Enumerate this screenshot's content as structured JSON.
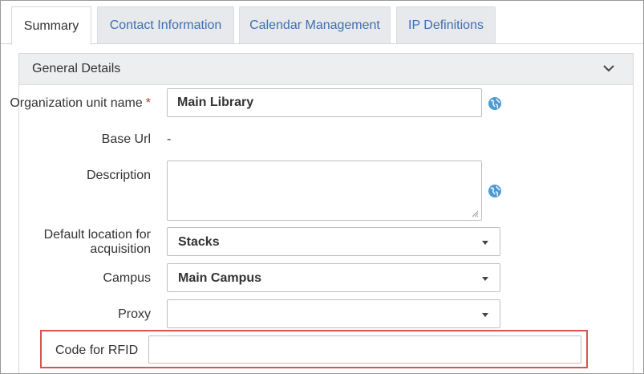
{
  "tabs": [
    {
      "label": "Summary"
    },
    {
      "label": "Contact Information"
    },
    {
      "label": "Calendar Management"
    },
    {
      "label": "IP Definitions"
    }
  ],
  "panel": {
    "title": "General Details"
  },
  "fields": {
    "org_unit_name": {
      "label": "Organization unit name",
      "required_mark": "*",
      "value": "Main Library"
    },
    "base_url": {
      "label": "Base Url",
      "value": "-"
    },
    "description": {
      "label": "Description",
      "value": ""
    },
    "default_location": {
      "label_line1": "Default location for",
      "label_line2": "acquisition",
      "value": "Stacks"
    },
    "campus": {
      "label": "Campus",
      "value": "Main Campus"
    },
    "proxy": {
      "label": "Proxy",
      "value": ""
    },
    "rfid": {
      "label": "Code for RFID",
      "value": ""
    }
  },
  "colors": {
    "link_blue": "#3d6fb4",
    "highlight_red": "#d9534f",
    "required_red": "#c0392b"
  },
  "icons": {
    "collapse": "chevron-down-icon",
    "translate": "globe-icon",
    "dropdown": "caret-down-icon"
  }
}
